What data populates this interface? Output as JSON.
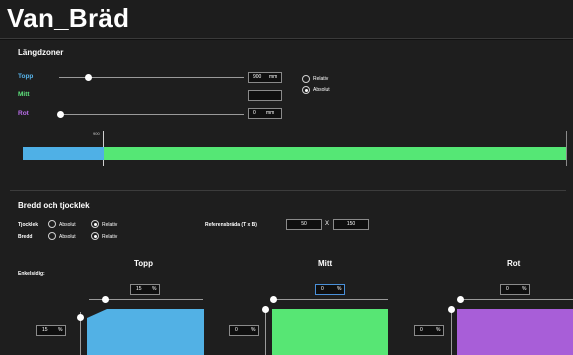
{
  "app": {
    "title": "Van_Bräd"
  },
  "langdzoner": {
    "heading": "Längdzoner",
    "rows": [
      {
        "label": "Topp",
        "color": "#58b4ea",
        "value": "900",
        "unit": "mm"
      },
      {
        "label": "Mitt",
        "color": "#5ee37c",
        "value": "",
        "unit": ""
      },
      {
        "label": "Rot",
        "color": "#b86de8",
        "value": "0",
        "unit": "mm"
      }
    ],
    "mode": {
      "relativ": "Relativ",
      "absolut": "Absolut",
      "selected": "Absolut"
    },
    "bar": {
      "marker": "900",
      "blue": "#4fb0e6",
      "green": "#55e775"
    }
  },
  "bredd_tjocklek": {
    "heading": "Bredd och tjocklek",
    "tjocklek": {
      "label": "Tjocklek",
      "absolut": "Absolut",
      "relativ": "Relativ",
      "selected": "Relativ"
    },
    "bredd": {
      "label": "Bredd",
      "absolut": "Absolut",
      "relativ": "Relativ",
      "selected": "Relativ"
    },
    "referens": {
      "label": "Referensbräda (T x B)",
      "t": "50",
      "x": "X",
      "b": "150"
    }
  },
  "zones": {
    "enkelsidig": "Enkelsidig:",
    "topp": {
      "title": "Topp",
      "top_value": "15",
      "side_value": "15",
      "unit": "%",
      "color": "#52b1e5"
    },
    "mitt": {
      "title": "Mitt",
      "top_value": "0",
      "side_value": "0",
      "unit": "%",
      "color": "#57e674"
    },
    "rot": {
      "title": "Rot",
      "top_value": "0",
      "side_value": "0",
      "unit": "%",
      "color": "#a85ed8"
    }
  }
}
